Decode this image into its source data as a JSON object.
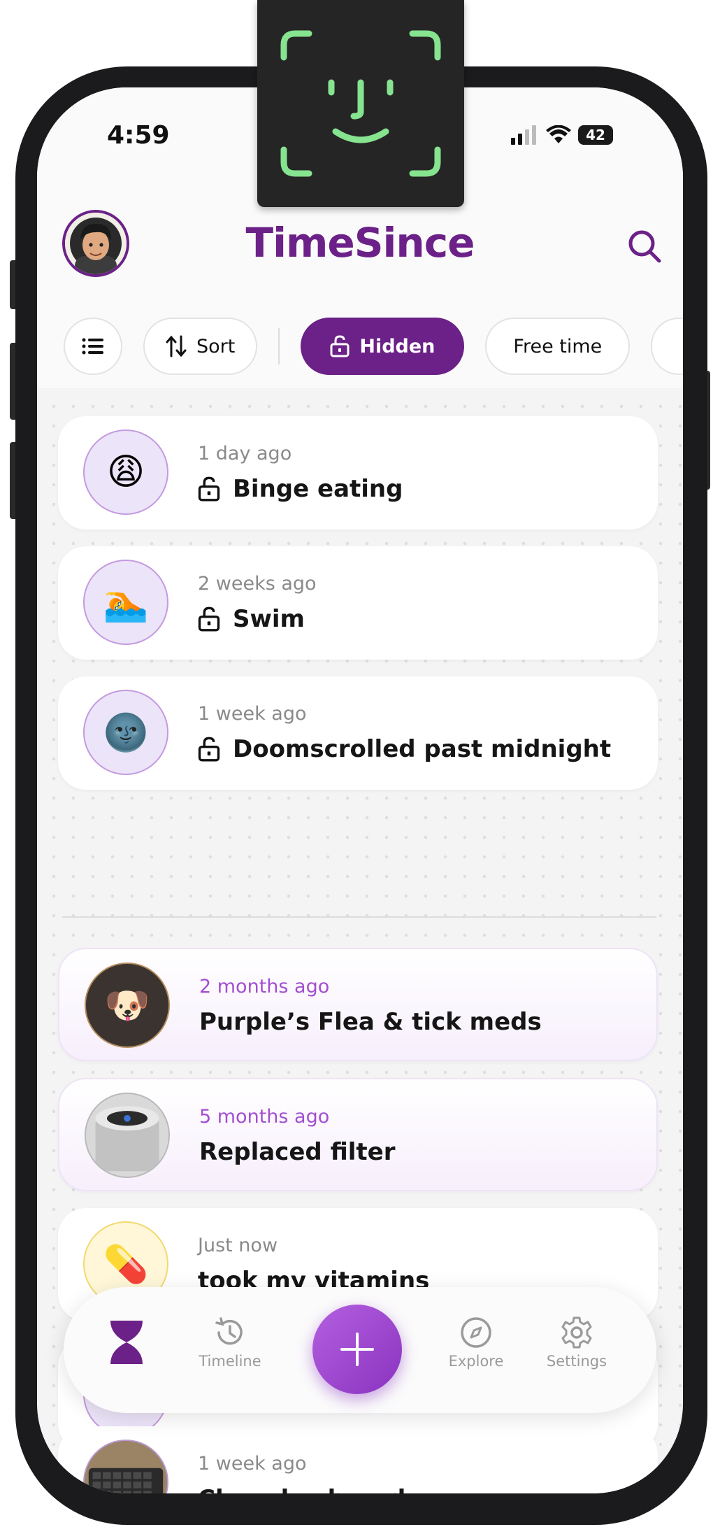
{
  "status_bar": {
    "time": "4:59",
    "battery": "42"
  },
  "header": {
    "title": "TimeSince"
  },
  "chips": {
    "list_view": "",
    "sort": "Sort",
    "hidden": "Hidden",
    "free_time": "Free time"
  },
  "hidden_items": [
    {
      "ago": "1 day ago",
      "title": "Binge eating",
      "emoji": "😩",
      "icon": "weary-face-icon"
    },
    {
      "ago": "2 weeks ago",
      "title": "Swim",
      "emoji": "🏊",
      "icon": "swimmer-icon"
    },
    {
      "ago": "1 week ago",
      "title": "Doomscrolled past midnight",
      "emoji": "🌚",
      "icon": "new-moon-face-icon"
    }
  ],
  "items": [
    {
      "ago": "2 months ago",
      "title": "Purple’s Flea & tick meds",
      "emoji": "🐶",
      "icon": "poodle-photo"
    },
    {
      "ago": "5 months ago",
      "title": "Replaced filter",
      "emoji": "🌀",
      "icon": "air-purifier-photo"
    },
    {
      "ago": "Just now",
      "title": "took my vitamins",
      "emoji": "💊",
      "icon": "pill-icon"
    },
    {
      "ago": "1 week ago",
      "title": "Clean keyboard",
      "emoji": "⌨️",
      "icon": "keyboard-photo"
    }
  ],
  "nav": {
    "timeline": "Timeline",
    "explore": "Explore",
    "settings": "Settings"
  },
  "colors": {
    "brand": "#6b2187",
    "accent": "#a24fd0",
    "face_id": "#86e38f"
  }
}
